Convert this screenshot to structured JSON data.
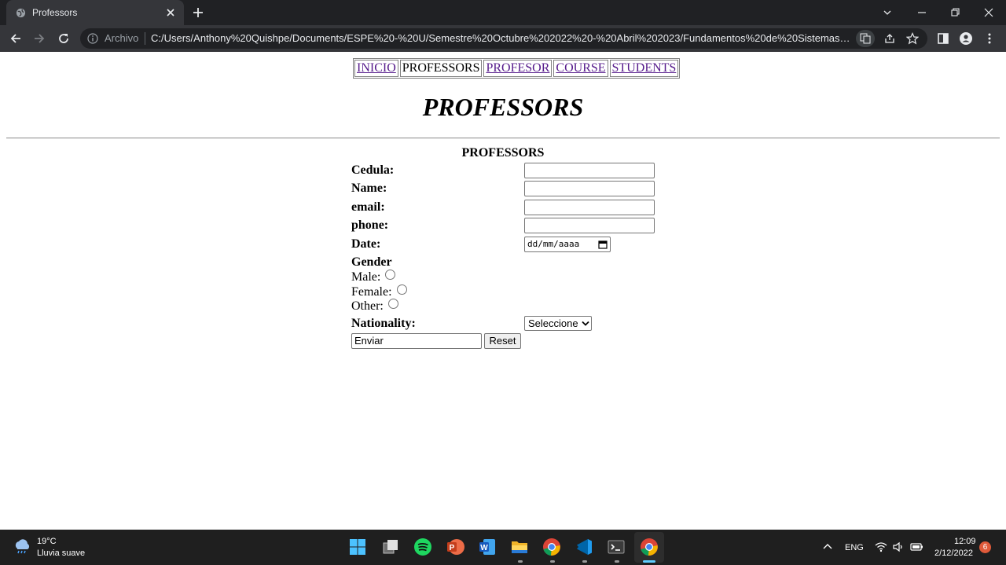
{
  "browser": {
    "tab_title": "Professors",
    "scheme_label": "Archivo",
    "url": "C:/Users/Anthony%20Quishpe/Documents/ESPE%20-%20U/Semestre%20Octubre%202022%20-%20Abril%202023/Fundamentos%20de%20Sistemas%2..."
  },
  "nav": {
    "items": [
      {
        "label": "INICIO",
        "link": true
      },
      {
        "label": "PROFESSORS",
        "link": false
      },
      {
        "label": "PROFESOR",
        "link": true
      },
      {
        "label": "COURSE",
        "link": true
      },
      {
        "label": "STUDENTS",
        "link": true
      }
    ]
  },
  "page": {
    "title": "PROFESSORS"
  },
  "form": {
    "caption": "PROFESSORS",
    "cedula_label": "Cedula:",
    "name_label": "Name:",
    "email_label": "email:",
    "phone_label": "phone:",
    "date_label": "Date:",
    "date_placeholder": "dd/mm/aaaa",
    "gender_label": "Gender",
    "gender_options": [
      "Male:",
      "Female:",
      "Other:"
    ],
    "nationality_label": "Nationality:",
    "nationality_selected": "Seleccione",
    "submit_label": "Enviar",
    "reset_label": "Reset"
  },
  "taskbar": {
    "weather_temp": "19°C",
    "weather_desc": "Lluvia suave",
    "language": "ENG",
    "time": "12:09",
    "date": "2/12/2022",
    "notification_count": "6"
  }
}
